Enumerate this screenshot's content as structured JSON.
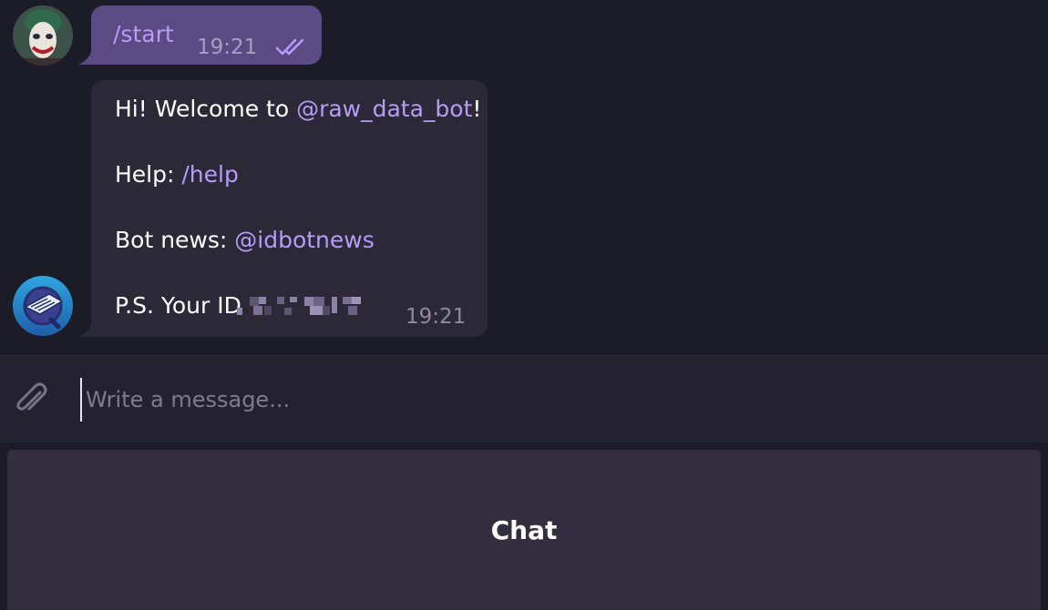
{
  "messages": {
    "outgoing": {
      "text": "/start",
      "time": "19:21",
      "status_icon": "double-check-icon"
    },
    "incoming": {
      "greeting_prefix": "Hi! Welcome to ",
      "greeting_link": "@raw_data_bot",
      "greeting_suffix": "!",
      "help_prefix": "Help: ",
      "help_link": "/help",
      "news_prefix": "Bot news: ",
      "news_link": "@idbotnews",
      "id_prefix": "P.S. Your ID",
      "time": "19:21"
    }
  },
  "composer": {
    "placeholder": "Write a message...",
    "attach_icon": "paperclip-icon"
  },
  "keyboard": {
    "button_label": "Chat"
  },
  "colors": {
    "background": "#1c1b28",
    "outgoing_bubble": "#5c4a84",
    "incoming_bubble": "#2b2838",
    "link": "#b79cf7",
    "composer": "#242231",
    "keyboard_button": "#322e40"
  }
}
